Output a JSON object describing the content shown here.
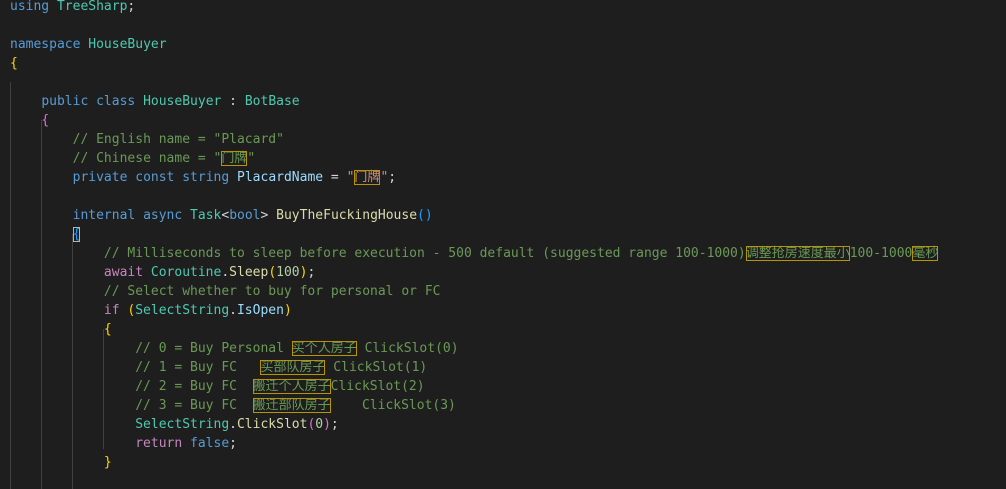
{
  "editor": {
    "lines": [
      [
        {
          "t": "using",
          "c": "kw"
        },
        {
          "t": " ",
          "c": "plain"
        },
        {
          "t": "TreeSharp",
          "c": "type"
        },
        {
          "t": ";",
          "c": "plain"
        }
      ],
      [],
      [
        {
          "t": "namespace",
          "c": "kw"
        },
        {
          "t": " ",
          "c": "plain"
        },
        {
          "t": "HouseBuyer",
          "c": "type"
        }
      ],
      [
        {
          "t": "{",
          "c": "brace-y"
        }
      ],
      [],
      [
        {
          "t": "    ",
          "c": "plain"
        },
        {
          "t": "public",
          "c": "kw"
        },
        {
          "t": " ",
          "c": "plain"
        },
        {
          "t": "class",
          "c": "kw"
        },
        {
          "t": " ",
          "c": "plain"
        },
        {
          "t": "HouseBuyer",
          "c": "type"
        },
        {
          "t": " : ",
          "c": "plain"
        },
        {
          "t": "BotBase",
          "c": "type"
        }
      ],
      [
        {
          "t": "    ",
          "c": "plain"
        },
        {
          "t": "{",
          "c": "brace-p"
        }
      ],
      [
        {
          "t": "        ",
          "c": "plain"
        },
        {
          "t": "// English name = \"Placard\"",
          "c": "com"
        }
      ],
      [
        {
          "t": "        ",
          "c": "plain"
        },
        {
          "t": "// Chinese name = \"",
          "c": "com"
        },
        {
          "t": "门牌",
          "c": "com hl"
        },
        {
          "t": "\"",
          "c": "com"
        }
      ],
      [
        {
          "t": "        ",
          "c": "plain"
        },
        {
          "t": "private",
          "c": "kw"
        },
        {
          "t": " ",
          "c": "plain"
        },
        {
          "t": "const",
          "c": "kw"
        },
        {
          "t": " ",
          "c": "plain"
        },
        {
          "t": "string",
          "c": "kw"
        },
        {
          "t": " ",
          "c": "plain"
        },
        {
          "t": "PlacardName",
          "c": "var"
        },
        {
          "t": " = ",
          "c": "plain"
        },
        {
          "t": "\"",
          "c": "str"
        },
        {
          "t": "门牌",
          "c": "str hl"
        },
        {
          "t": "\"",
          "c": "str"
        },
        {
          "t": ";",
          "c": "plain"
        }
      ],
      [],
      [
        {
          "t": "        ",
          "c": "plain"
        },
        {
          "t": "internal",
          "c": "kw"
        },
        {
          "t": " ",
          "c": "plain"
        },
        {
          "t": "async",
          "c": "kw"
        },
        {
          "t": " ",
          "c": "plain"
        },
        {
          "t": "Task",
          "c": "type"
        },
        {
          "t": "<",
          "c": "plain"
        },
        {
          "t": "bool",
          "c": "kw"
        },
        {
          "t": "> ",
          "c": "plain"
        },
        {
          "t": "BuyTheFuckingHouse",
          "c": "fn"
        },
        {
          "t": "()",
          "c": "brace-b"
        }
      ],
      [
        {
          "t": "        ",
          "c": "plain"
        },
        {
          "t": "{",
          "c": "brace-b bm"
        }
      ],
      [
        {
          "t": "            ",
          "c": "plain"
        },
        {
          "t": "// Milliseconds to sleep before execution - 500 default (suggested range 100-1000)",
          "c": "com"
        },
        {
          "t": "调整抢房速度最小",
          "c": "com hl"
        },
        {
          "t": "100-1000",
          "c": "com"
        },
        {
          "t": "毫秒",
          "c": "com hl"
        }
      ],
      [
        {
          "t": "            ",
          "c": "plain"
        },
        {
          "t": "await",
          "c": "ctrl"
        },
        {
          "t": " ",
          "c": "plain"
        },
        {
          "t": "Coroutine",
          "c": "type"
        },
        {
          "t": ".",
          "c": "plain"
        },
        {
          "t": "Sleep",
          "c": "fn"
        },
        {
          "t": "(",
          "c": "brace-y"
        },
        {
          "t": "100",
          "c": "num"
        },
        {
          "t": ")",
          "c": "brace-y"
        },
        {
          "t": ";",
          "c": "plain"
        }
      ],
      [
        {
          "t": "            ",
          "c": "plain"
        },
        {
          "t": "// Select whether to buy for personal or FC",
          "c": "com"
        }
      ],
      [
        {
          "t": "            ",
          "c": "plain"
        },
        {
          "t": "if",
          "c": "ctrl"
        },
        {
          "t": " ",
          "c": "plain"
        },
        {
          "t": "(",
          "c": "brace-y"
        },
        {
          "t": "SelectString",
          "c": "type"
        },
        {
          "t": ".",
          "c": "plain"
        },
        {
          "t": "IsOpen",
          "c": "var"
        },
        {
          "t": ")",
          "c": "brace-y"
        }
      ],
      [
        {
          "t": "            ",
          "c": "plain"
        },
        {
          "t": "{",
          "c": "brace-y"
        }
      ],
      [
        {
          "t": "                ",
          "c": "plain"
        },
        {
          "t": "// 0 = Buy Personal ",
          "c": "com"
        },
        {
          "t": "买个人房子",
          "c": "com hl"
        },
        {
          "t": " ClickSlot(0)",
          "c": "com"
        }
      ],
      [
        {
          "t": "                ",
          "c": "plain"
        },
        {
          "t": "// 1 = Buy FC   ",
          "c": "com"
        },
        {
          "t": "买部队房子",
          "c": "com hl"
        },
        {
          "t": " ClickSlot(1)",
          "c": "com"
        }
      ],
      [
        {
          "t": "                ",
          "c": "plain"
        },
        {
          "t": "// 2 = Buy FC  ",
          "c": "com"
        },
        {
          "t": "搬迁个人房子",
          "c": "com hl"
        },
        {
          "t": "ClickSlot(2)",
          "c": "com"
        }
      ],
      [
        {
          "t": "                ",
          "c": "plain"
        },
        {
          "t": "// 3 = Buy FC  ",
          "c": "com"
        },
        {
          "t": "搬迁部队房子",
          "c": "com hl"
        },
        {
          "t": "    ClickSlot(3)",
          "c": "com"
        }
      ],
      [
        {
          "t": "                ",
          "c": "plain"
        },
        {
          "t": "SelectString",
          "c": "type"
        },
        {
          "t": ".",
          "c": "plain"
        },
        {
          "t": "ClickSlot",
          "c": "fn"
        },
        {
          "t": "(",
          "c": "brace-p"
        },
        {
          "t": "0",
          "c": "num"
        },
        {
          "t": ")",
          "c": "brace-p"
        },
        {
          "t": ";",
          "c": "plain"
        }
      ],
      [
        {
          "t": "                ",
          "c": "plain"
        },
        {
          "t": "return",
          "c": "ctrl"
        },
        {
          "t": " ",
          "c": "plain"
        },
        {
          "t": "false",
          "c": "kw"
        },
        {
          "t": ";",
          "c": "plain"
        }
      ],
      [
        {
          "t": "            ",
          "c": "plain"
        },
        {
          "t": "}",
          "c": "brace-y"
        }
      ],
      []
    ]
  }
}
